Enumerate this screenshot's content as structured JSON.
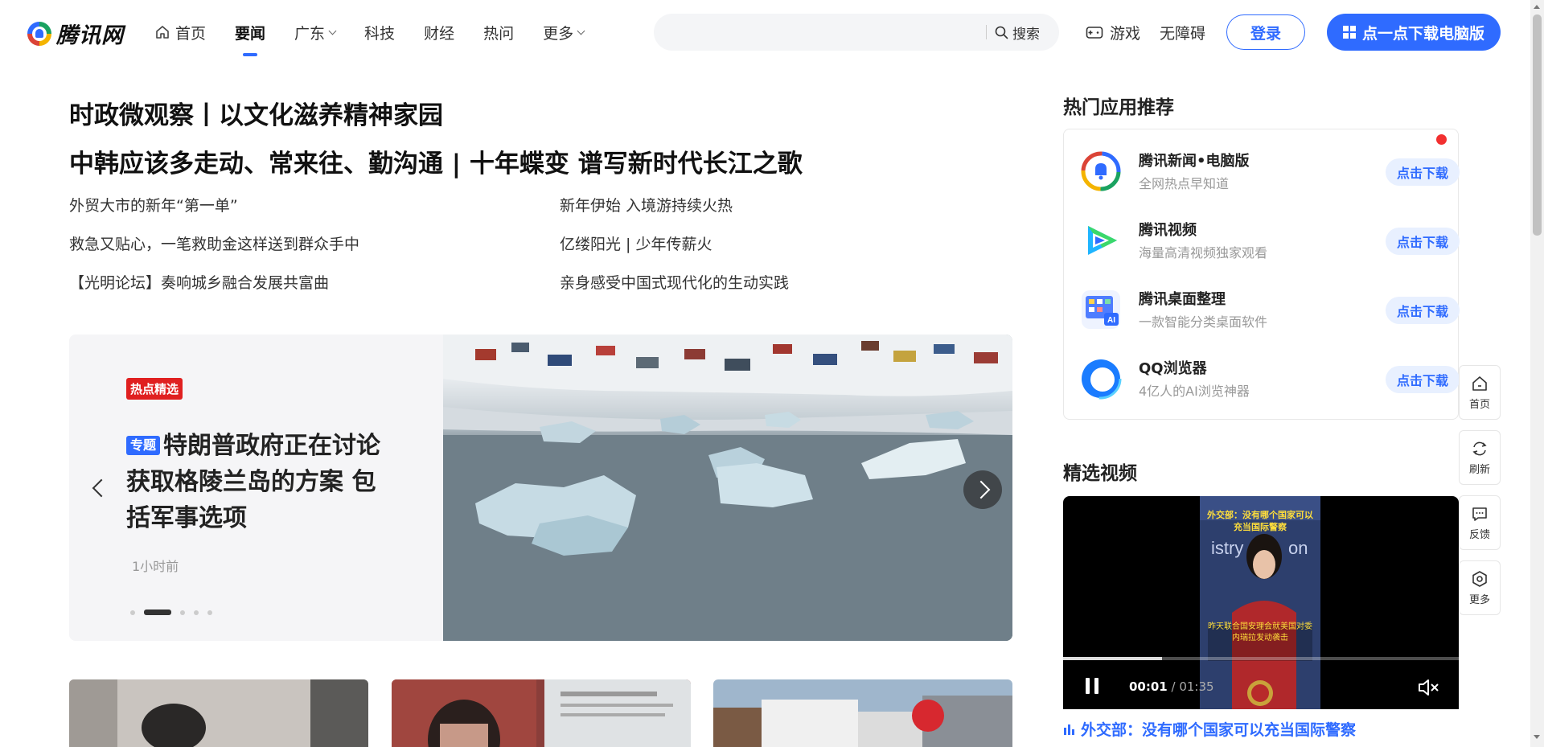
{
  "header": {
    "logo_text": "腾讯网",
    "nav": [
      {
        "label": "首页",
        "icon": "home-icon"
      },
      {
        "label": "要闻",
        "active": true
      },
      {
        "label": "广东",
        "dropdown": true
      },
      {
        "label": "科技"
      },
      {
        "label": "财经"
      },
      {
        "label": "热问"
      },
      {
        "label": "更多",
        "dropdown": true
      }
    ],
    "search": {
      "placeholder": "",
      "button_label": "搜索"
    },
    "games_label": "游戏",
    "accessibility_label": "无障碍",
    "login_label": "登录",
    "download_label": "点一点下载电脑版"
  },
  "main": {
    "headline1": "时政微观察丨以文化滋养精神家园",
    "headline2": "中韩应该多走动、常来往、勤沟通 | 十年蝶变 谱写新时代长江之歌",
    "sub_news": [
      "外贸大市的新年“第一单”",
      "新年伊始 入境游持续火热",
      "救急又贴心，一笔救助金这样送到群众手中",
      "亿缕阳光 | 少年传薪火",
      "【光明论坛】奏响城乡融合发展共富曲",
      "亲身感受中国式现代化的生动实践"
    ]
  },
  "carousel": {
    "badge": "热点精选",
    "topic_badge": "专题",
    "title": "特朗普政府正在讨论获取格陵兰岛的方案 包括军事选项",
    "time": "1小时前",
    "slide_count": 5,
    "active_slide": 2
  },
  "right": {
    "apps_title": "热门应用推荐",
    "apps": [
      {
        "name": "腾讯新闻•电脑版",
        "desc": "全网热点早知道",
        "button": "点击下载",
        "icon": "tencent-news-app-icon"
      },
      {
        "name": "腾讯视频",
        "desc": "海量高清视频独家观看",
        "button": "点击下载",
        "icon": "tencent-video-app-icon"
      },
      {
        "name": "腾讯桌面整理",
        "desc": "一款智能分类桌面软件",
        "button": "点击下载",
        "icon": "desktop-organizer-app-icon"
      },
      {
        "name": "QQ浏览器",
        "desc": "4亿人的AI浏览神器",
        "button": "点击下载",
        "icon": "qq-browser-app-icon"
      }
    ],
    "video_title": "精选视频",
    "video": {
      "current_time": "00:01",
      "separator": " / ",
      "duration": "01:35",
      "progress": 0.25,
      "overlay_top": "外交部：没有哪个国家可以充当国际警察",
      "overlay_bottom": "昨天联合国安理会就美国对委内瑞拉发动袭击",
      "caption": "外交部：没有哪个国家可以充当国际警察"
    }
  },
  "floating": [
    {
      "label": "首页",
      "icon": "home-icon"
    },
    {
      "label": "刷新",
      "icon": "refresh-icon"
    },
    {
      "label": "反馈",
      "icon": "feedback-icon"
    },
    {
      "label": "更多",
      "icon": "more-icon"
    }
  ],
  "colors": {
    "brand_blue": "#2f6bff",
    "hot_red": "#e02020",
    "text_dark": "#222222",
    "text_muted": "#999999"
  }
}
